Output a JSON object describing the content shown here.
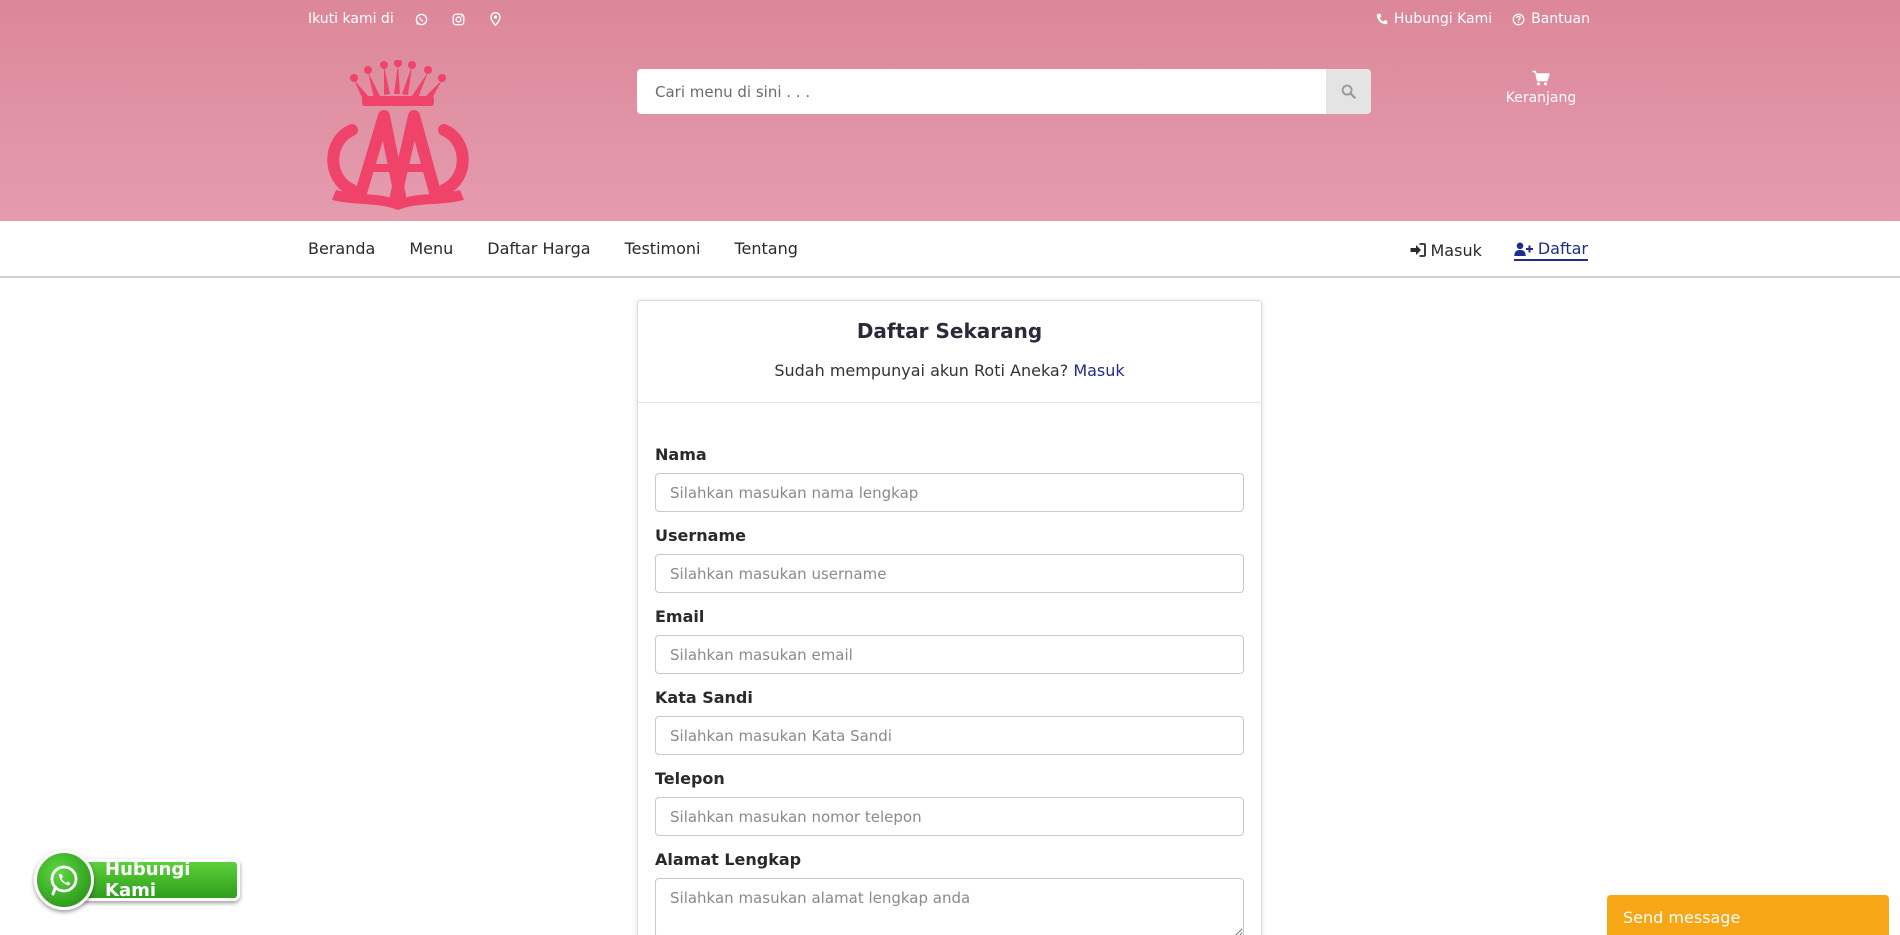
{
  "topbar": {
    "follow_text": "Ikuti kami di",
    "social_icons": [
      "whatsapp-icon",
      "instagram-icon",
      "map-marker-icon"
    ],
    "contact_label": "Hubungi Kami",
    "help_label": "Bantuan"
  },
  "search": {
    "placeholder": "Cari menu di sini . . ."
  },
  "cart": {
    "label": "Keranjang"
  },
  "nav": {
    "items": [
      {
        "label": "Beranda"
      },
      {
        "label": "Menu"
      },
      {
        "label": "Daftar Harga"
      },
      {
        "label": "Testimoni"
      },
      {
        "label": "Tentang"
      }
    ],
    "login_label": "Masuk",
    "register_label": "Daftar"
  },
  "card": {
    "title": "Daftar Sekarang",
    "subtitle": "Sudah mempunyai akun Roti Aneka?",
    "login_link": "Masuk",
    "fields": [
      {
        "label": "Nama",
        "placeholder": "Silahkan masukan nama lengkap"
      },
      {
        "label": "Username",
        "placeholder": "Silahkan masukan username"
      },
      {
        "label": "Email",
        "placeholder": "Silahkan masukan email"
      },
      {
        "label": "Kata Sandi",
        "placeholder": "Silahkan masukan Kata Sandi"
      },
      {
        "label": "Telepon",
        "placeholder": "Silahkan masukan nomor telepon"
      },
      {
        "label": "Alamat Lengkap",
        "placeholder": "Silahkan masukan alamat lengkap anda"
      }
    ]
  },
  "whatsapp_button": {
    "label": "Hubungi Kami"
  },
  "chat_widget": {
    "label": "Send message"
  },
  "colors": {
    "header_top": "#dc8799",
    "header_bottom": "#e59caf",
    "logo": "#f0436a",
    "link": "#1f2d8c",
    "whatsapp": "#3bb324",
    "send_message": "#f7a715"
  }
}
